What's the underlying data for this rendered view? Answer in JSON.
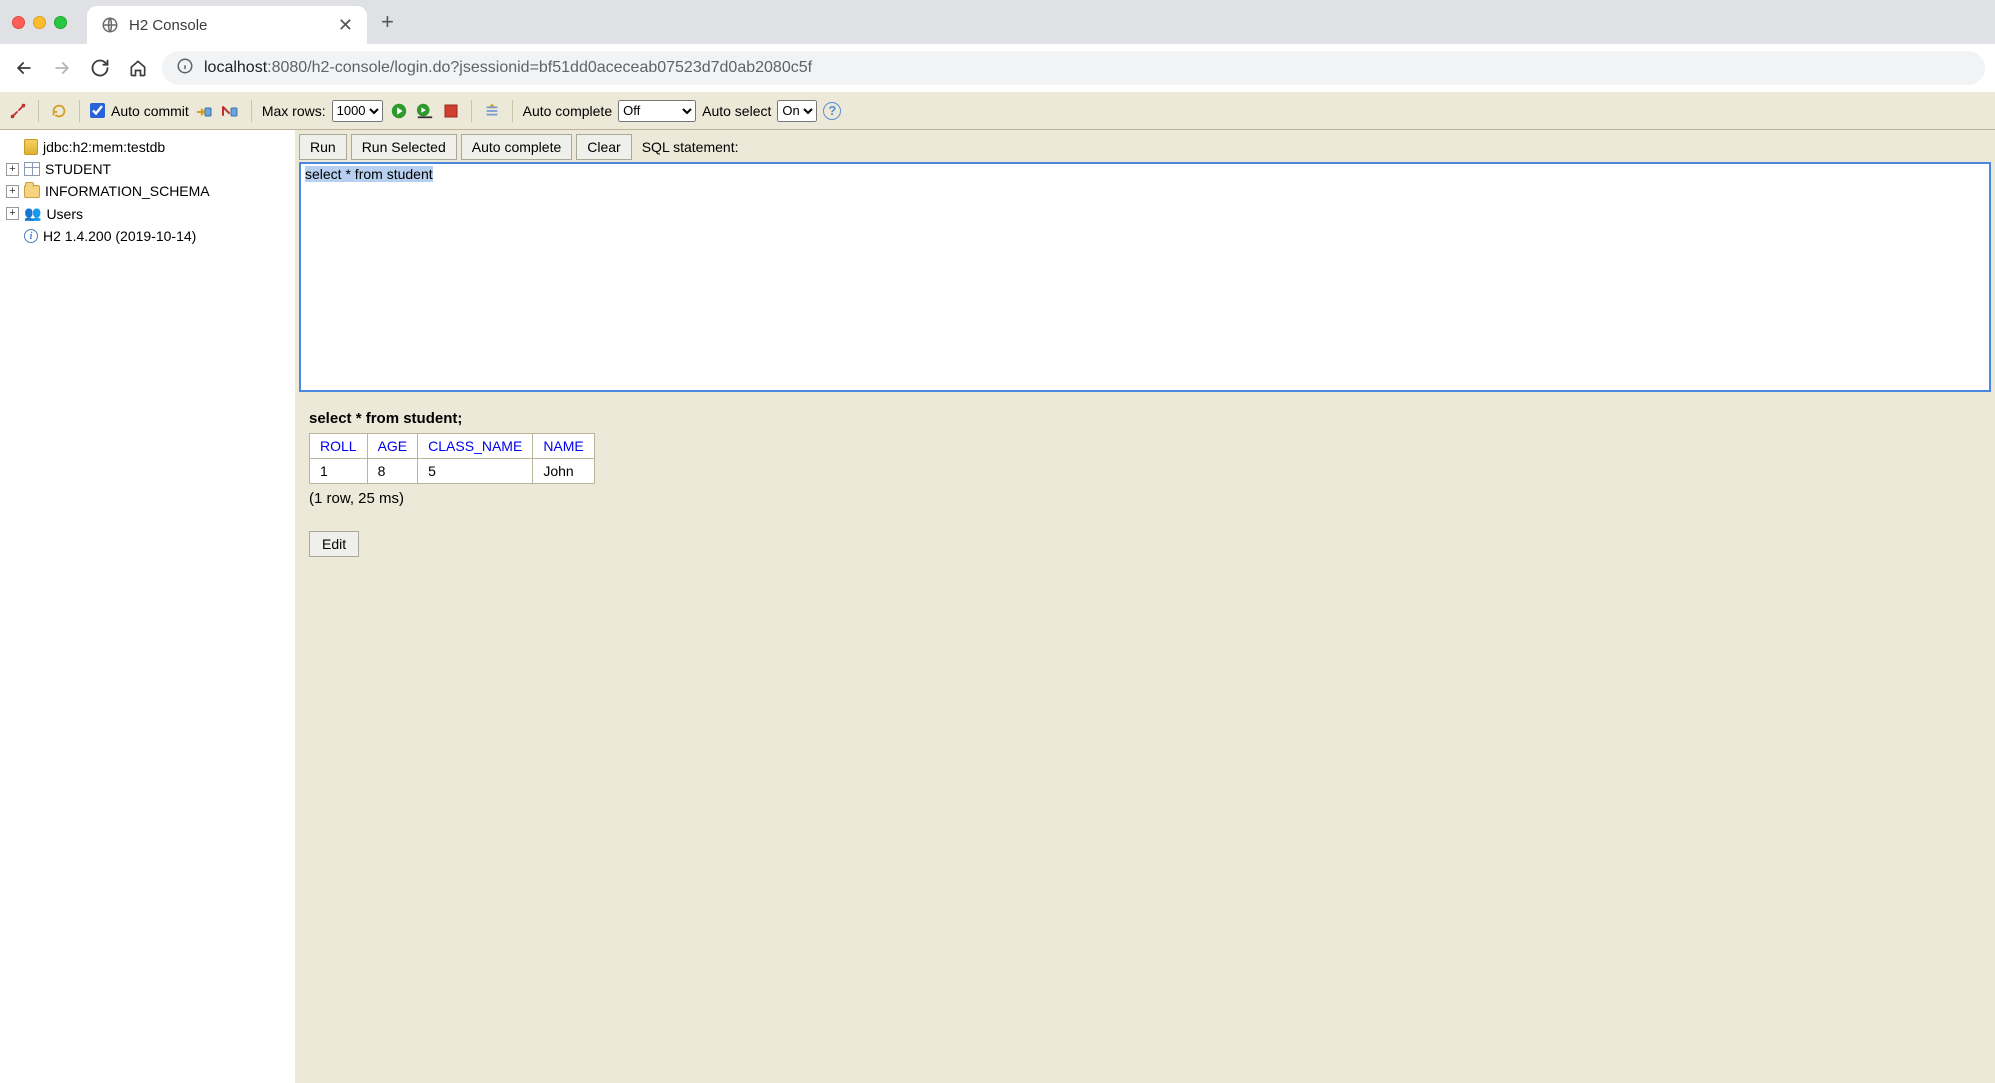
{
  "browser": {
    "tab_title": "H2 Console",
    "url_host": "localhost",
    "url_port_path": ":8080/h2-console/login.do?jsessionid=bf51dd0aceceab07523d7d0ab2080c5f"
  },
  "toolbar": {
    "auto_commit_label": "Auto commit",
    "max_rows_label": "Max rows:",
    "max_rows_value": "1000",
    "auto_complete_label": "Auto complete",
    "auto_complete_value": "Off",
    "auto_select_label": "Auto select",
    "auto_select_value": "On",
    "help_glyph": "?"
  },
  "sidebar": {
    "connection": "jdbc:h2:mem:testdb",
    "items": [
      {
        "label": "STUDENT"
      },
      {
        "label": "INFORMATION_SCHEMA"
      },
      {
        "label": "Users"
      }
    ],
    "version": "H2 1.4.200 (2019-10-14)"
  },
  "sql_bar": {
    "run": "Run",
    "run_selected": "Run Selected",
    "auto_complete": "Auto complete",
    "clear": "Clear",
    "label": "SQL statement:"
  },
  "editor": {
    "text": "select * from student"
  },
  "results": {
    "statement": "select * from student;",
    "columns": [
      "ROLL",
      "AGE",
      "CLASS_NAME",
      "NAME"
    ],
    "rows": [
      {
        "ROLL": "1",
        "AGE": "8",
        "CLASS_NAME": "5",
        "NAME": "John"
      }
    ],
    "summary": "(1 row, 25 ms)",
    "edit_label": "Edit"
  }
}
